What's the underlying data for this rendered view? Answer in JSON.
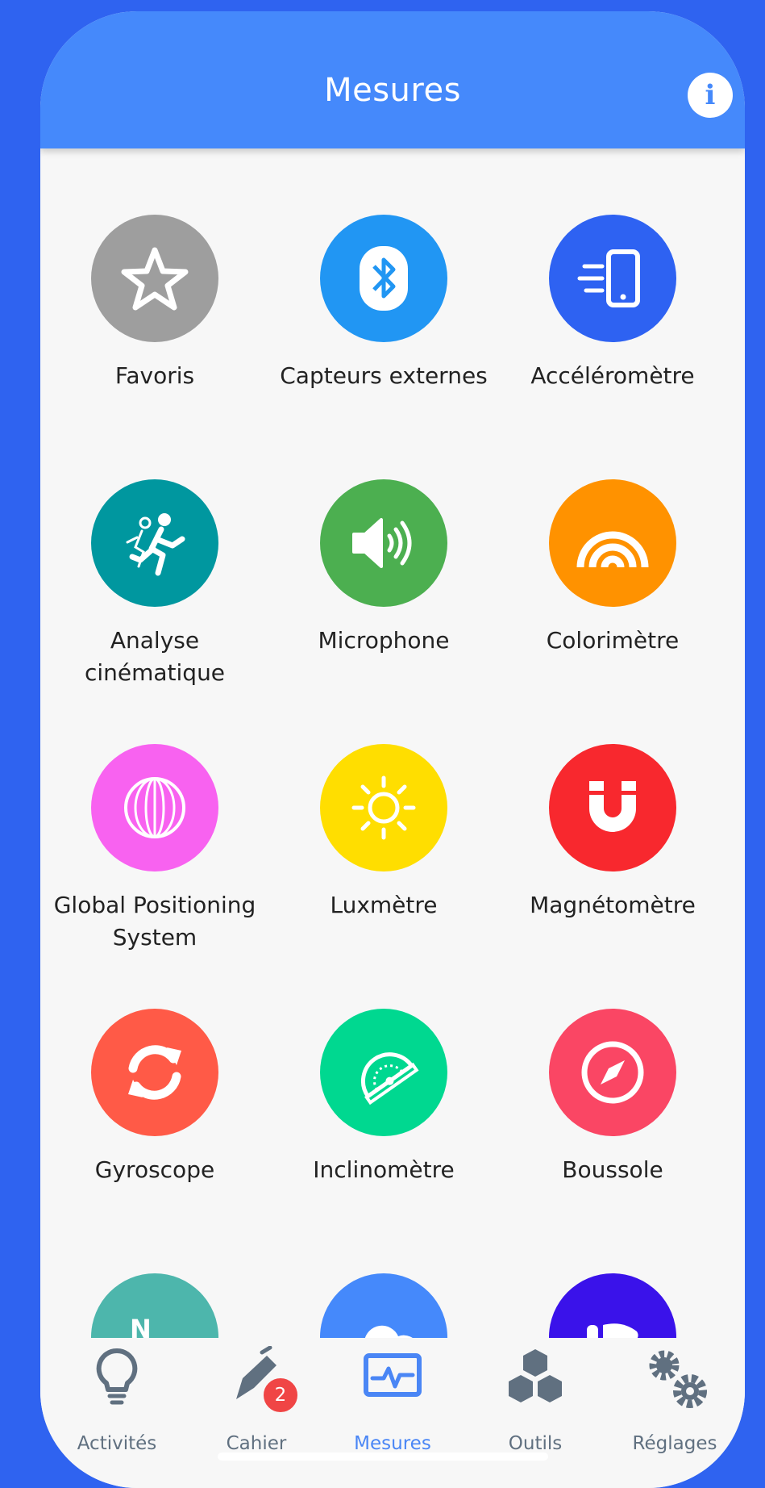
{
  "header": {
    "title": "Mesures",
    "info_label": "i"
  },
  "tiles": [
    {
      "label": "Favoris",
      "color": "#9e9e9e",
      "icon": "star-icon"
    },
    {
      "label": "Capteurs externes",
      "color": "#2196f3",
      "icon": "bluetooth-icon"
    },
    {
      "label": "Accéléromètre",
      "color": "#2e62f2",
      "icon": "phone-motion-icon"
    },
    {
      "label": "Analyse cinématique",
      "color": "#00979f",
      "icon": "runners-icon"
    },
    {
      "label": "Microphone",
      "color": "#4caf50",
      "icon": "speaker-icon"
    },
    {
      "label": "Colorimètre",
      "color": "#ff9200",
      "icon": "rainbow-icon"
    },
    {
      "label": "Global Positioning System",
      "color": "#f862f0",
      "icon": "globe-icon"
    },
    {
      "label": "Luxmètre",
      "color": "#ffde00",
      "icon": "sun-icon"
    },
    {
      "label": "Magnétomètre",
      "color": "#f8282e",
      "icon": "magnet-icon"
    },
    {
      "label": "Gyroscope",
      "color": "#ff5a47",
      "icon": "rotate-icon"
    },
    {
      "label": "Inclinomètre",
      "color": "#00d890",
      "icon": "protractor-icon"
    },
    {
      "label": "Boussole",
      "color": "#fa4664",
      "icon": "compass-icon"
    },
    {
      "label": "",
      "color": "#4db6ac",
      "icon": "north-arrow-icon"
    },
    {
      "label": "",
      "color": "#4589fb",
      "icon": "cloud-icon"
    },
    {
      "label": "",
      "color": "#3a12ea",
      "icon": "footprint-icon"
    }
  ],
  "tabs": [
    {
      "label": "Activités",
      "icon": "lightbulb-icon",
      "active": false
    },
    {
      "label": "Cahier",
      "icon": "pen-icon",
      "active": false,
      "badge": "2"
    },
    {
      "label": "Mesures",
      "icon": "monitor-pulse-icon",
      "active": true
    },
    {
      "label": "Outils",
      "icon": "cubes-icon",
      "active": false
    },
    {
      "label": "Réglages",
      "icon": "gears-icon",
      "active": false
    }
  ]
}
